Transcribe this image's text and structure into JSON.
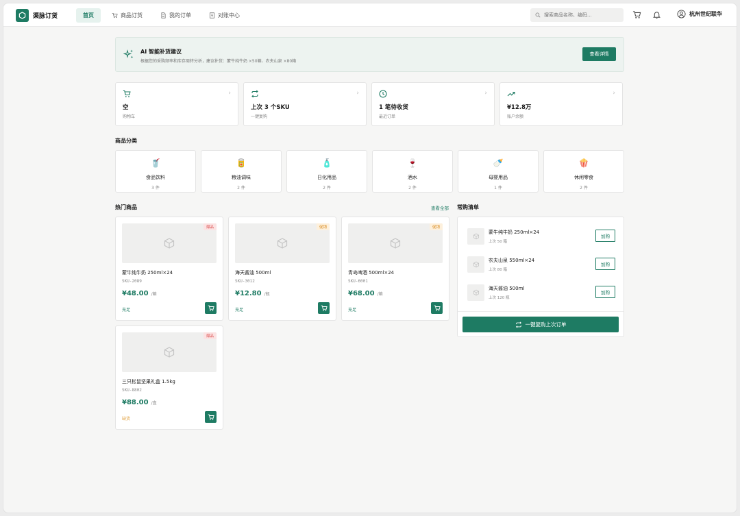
{
  "brand": "渠脉订货",
  "nav": [
    {
      "label": "首页",
      "icon": "home",
      "active": true
    },
    {
      "label": "商品订货",
      "icon": "cart-icon",
      "active": false
    },
    {
      "label": "我的订单",
      "icon": "document-icon",
      "active": false
    },
    {
      "label": "对账中心",
      "icon": "ledger-icon",
      "active": false
    }
  ],
  "search": {
    "placeholder": "搜索商品名称、编码..."
  },
  "user": {
    "name": "杭州世纪联华"
  },
  "banner": {
    "title": "AI 智能补货建议",
    "desc": "根据您的采购频率和库存周转分析，建议补货：蒙牛纯牛奶 ×50箱、农夫山泉 ×80箱",
    "button": "查看详情"
  },
  "stats": [
    {
      "value": "空",
      "label": "购物车",
      "icon": "cart-icon"
    },
    {
      "value": "上次 3 个SKU",
      "label": "一键复购",
      "icon": "repeat-icon"
    },
    {
      "value": "1 笔待收货",
      "label": "最近订单",
      "icon": "clock-icon"
    },
    {
      "value": "¥12.8万",
      "label": "账户余额",
      "icon": "trend-icon"
    }
  ],
  "categories_title": "商品分类",
  "categories": [
    {
      "name": "食品饮料",
      "count": "3 件",
      "emoji": "🥤"
    },
    {
      "name": "粮油调味",
      "count": "2 件",
      "emoji": "🥫"
    },
    {
      "name": "日化用品",
      "count": "2 件",
      "emoji": "🧴"
    },
    {
      "name": "酒水",
      "count": "2 件",
      "emoji": "🍷"
    },
    {
      "name": "母婴用品",
      "count": "1 件",
      "emoji": "🍼"
    },
    {
      "name": "休闲零食",
      "count": "2 件",
      "emoji": "🍿"
    }
  ],
  "hot_title": "热门商品",
  "view_all": "查看全部",
  "products": [
    {
      "name": "蒙牛纯牛奶 250ml×24",
      "sku": "SKU-2089",
      "price": "¥48.00",
      "unit": "/箱",
      "stock": "充足",
      "stock_color": "#1e7b63",
      "tag": "爆品",
      "tag_style": "red"
    },
    {
      "name": "海天酱油 500ml",
      "sku": "SKU-3012",
      "price": "¥12.80",
      "unit": "/瓶",
      "stock": "充足",
      "stock_color": "#1e7b63",
      "tag": "促销",
      "tag_style": "orange"
    },
    {
      "name": "青岛啤酒 500ml×24",
      "sku": "SKU-6001",
      "price": "¥68.00",
      "unit": "/箱",
      "stock": "充足",
      "stock_color": "#1e7b63",
      "tag": "促销",
      "tag_style": "orange"
    },
    {
      "name": "三只松鼠坚果礼盒 1.5kg",
      "sku": "SKU-8802",
      "price": "¥88.00",
      "unit": "/盒",
      "stock": "缺货",
      "stock_color": "#e0a040",
      "tag": "爆品",
      "tag_style": "red"
    }
  ],
  "frequent_title": "常购清单",
  "frequent": [
    {
      "name": "蒙牛纯牛奶 250ml×24",
      "last": "上次 50 箱",
      "button": "加购"
    },
    {
      "name": "农夫山泉 550ml×24",
      "last": "上次 80 箱",
      "button": "加购"
    },
    {
      "name": "海天酱油 500ml",
      "last": "上次 120 瓶",
      "button": "加购"
    }
  ],
  "reorder_button": "一键复购上次订单",
  "colors": {
    "accent": "#1e7b63",
    "red_tag": "#d55",
    "orange_tag": "#d98b1f"
  }
}
